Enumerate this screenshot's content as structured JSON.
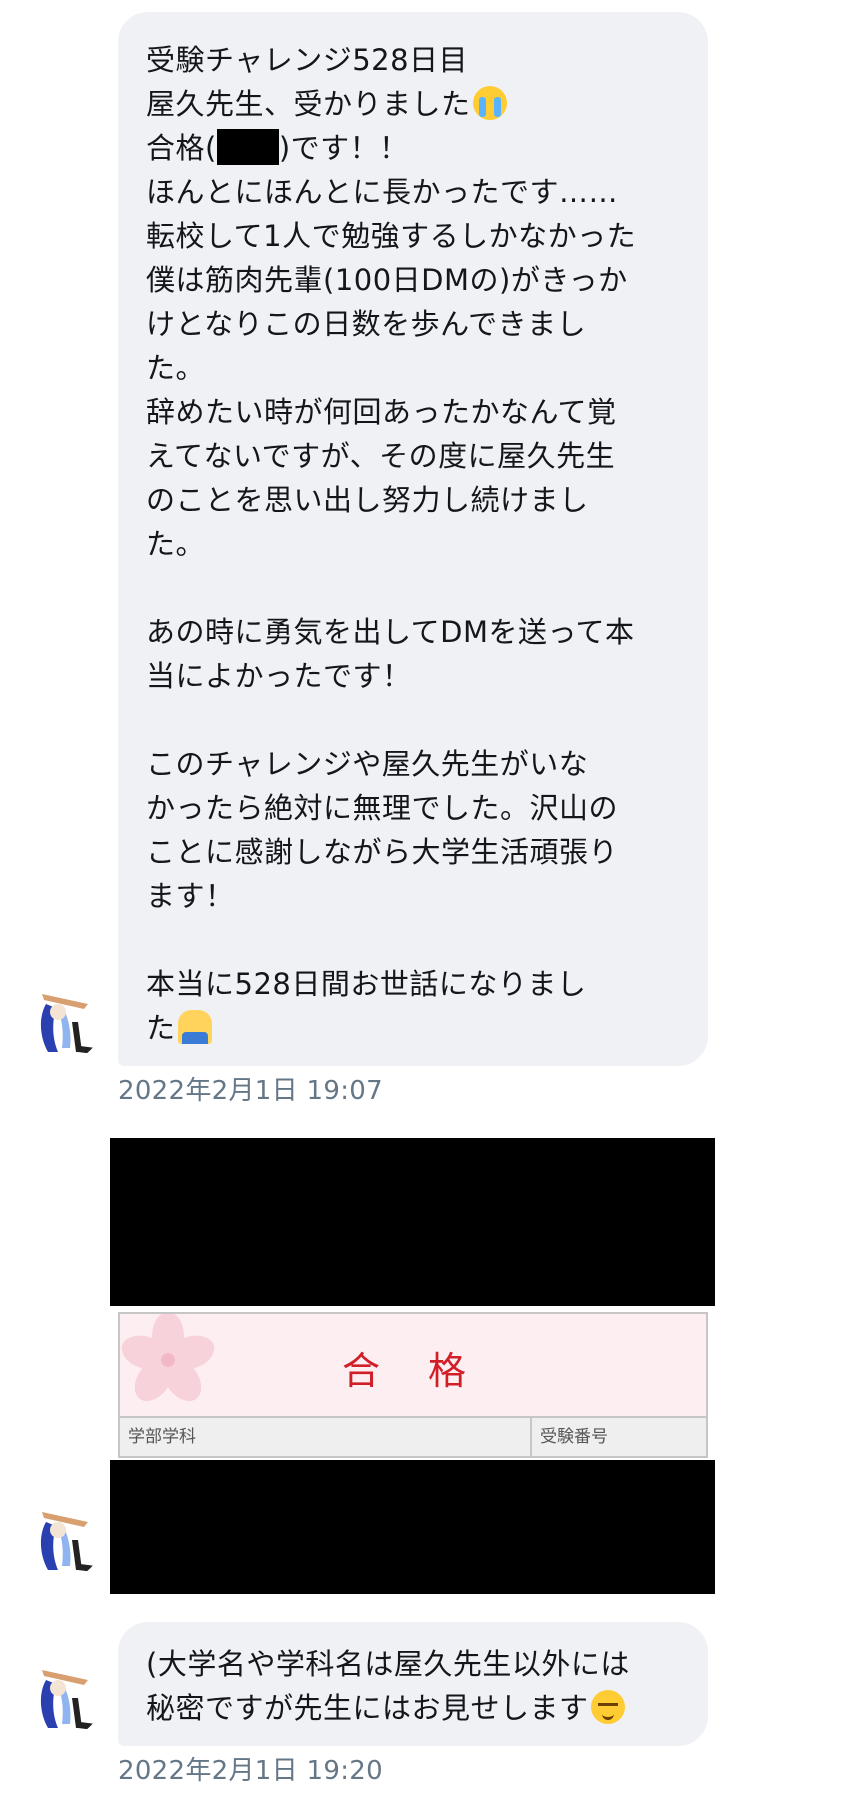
{
  "message1": {
    "lines": [
      "受験チャレンジ528日目",
      "屋久先生、受かりました",
      "合格(",
      ")です！！",
      "ほんとにほんとに長かったです……",
      "転校して1人で勉強するしかなかった",
      "僕は筋肉先輩(100日DMの)がきっか",
      "けとなりこの日数を歩んできまし",
      "た。",
      "辞めたい時が何回あったかなんて覚",
      "えてないですが、その度に屋久先生",
      "のことを思い出し努力し続けまし",
      "た。",
      "",
      "あの時に勇気を出してDMを送って本",
      "当によかったです！",
      "",
      "このチャレンジや屋久先生がいな",
      "かったら絶対に無理でした。沢山の",
      "ことに感謝しながら大学生活頑張り",
      "ます！",
      "",
      "本当に528日間お世話になりまし",
      "た"
    ],
    "timestamp": "2022年2月1日 19:07"
  },
  "result_card": {
    "title": "合 格",
    "col_faculty": "学部学科",
    "col_number": "受験番号",
    "accent_color": "#d11f28",
    "header_bg": "#fdeef2"
  },
  "message2": {
    "lines": [
      "(大学名や学科名は屋久先生以外には",
      "秘密ですが先生にはお見せします"
    ],
    "timestamp": "2022年2月1日 19:20"
  },
  "icons": {
    "emoji_1": "loudly-crying-face-icon",
    "emoji_2": "person-bowing-icon",
    "emoji_3": "relieved-face-icon",
    "avatar": "user-avatar-icon",
    "sakura": "cherry-blossom-icon"
  },
  "colors": {
    "bubble_bg": "#eff1f4",
    "timestamp": "#657786",
    "text": "#14171a"
  }
}
